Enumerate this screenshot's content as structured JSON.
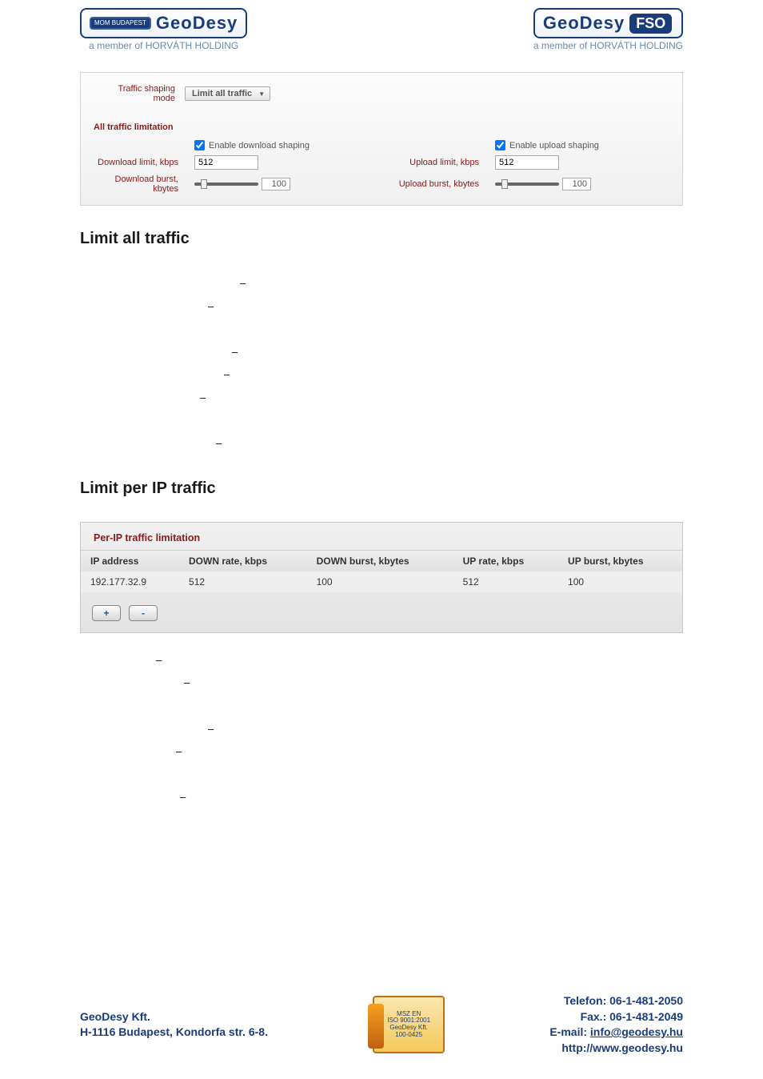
{
  "header": {
    "left_mom": "MOM\nBUDAPEST",
    "left_geodesy": "GeoDesy",
    "right_geodesy": "GeoDesy",
    "right_fso": "FSO",
    "tagline": "a member of HORVÁTH HOLDING"
  },
  "panel1": {
    "mode_label": "Traffic shaping mode",
    "mode_value": "Limit all traffic",
    "section_title": "All traffic limitation",
    "enable_dl": "Enable download shaping",
    "enable_ul": "Enable upload shaping",
    "dl_limit_label": "Download limit, kbps",
    "dl_limit_value": "512",
    "ul_limit_label": "Upload limit, kbps",
    "ul_limit_value": "512",
    "dl_burst_label": "Download burst, kbytes",
    "dl_burst_value": "100",
    "ul_burst_label": "Upload burst, kbytes",
    "ul_burst_value": "100"
  },
  "headings": {
    "h1": "Limit all traffic",
    "h2": "Limit per IP traffic"
  },
  "panel2": {
    "title": "Per-IP traffic limitation",
    "columns": [
      "IP address",
      "DOWN rate, kbps",
      "DOWN burst, kbytes",
      "UP rate, kbps",
      "UP burst, kbytes"
    ],
    "row": [
      "192.177.32.9",
      "512",
      "100",
      "512",
      "100"
    ],
    "plus": "+",
    "minus": "-"
  },
  "footer": {
    "company": "GeoDesy Kft.",
    "address": "H-1116 Budapest, Kondorfa str. 6-8.",
    "cert1": "MSZ EN",
    "cert2": "ISO 9001:2001",
    "cert3": "GeoDesy Kft.",
    "cert4": "100-0425",
    "tel": "Telefon: 06-1-481-2050",
    "fax": "Fax.: 06-1-481-2049",
    "email_label": "E-mail: ",
    "email": "info@geodesy.hu",
    "web": "http://www.geodesy.hu"
  }
}
